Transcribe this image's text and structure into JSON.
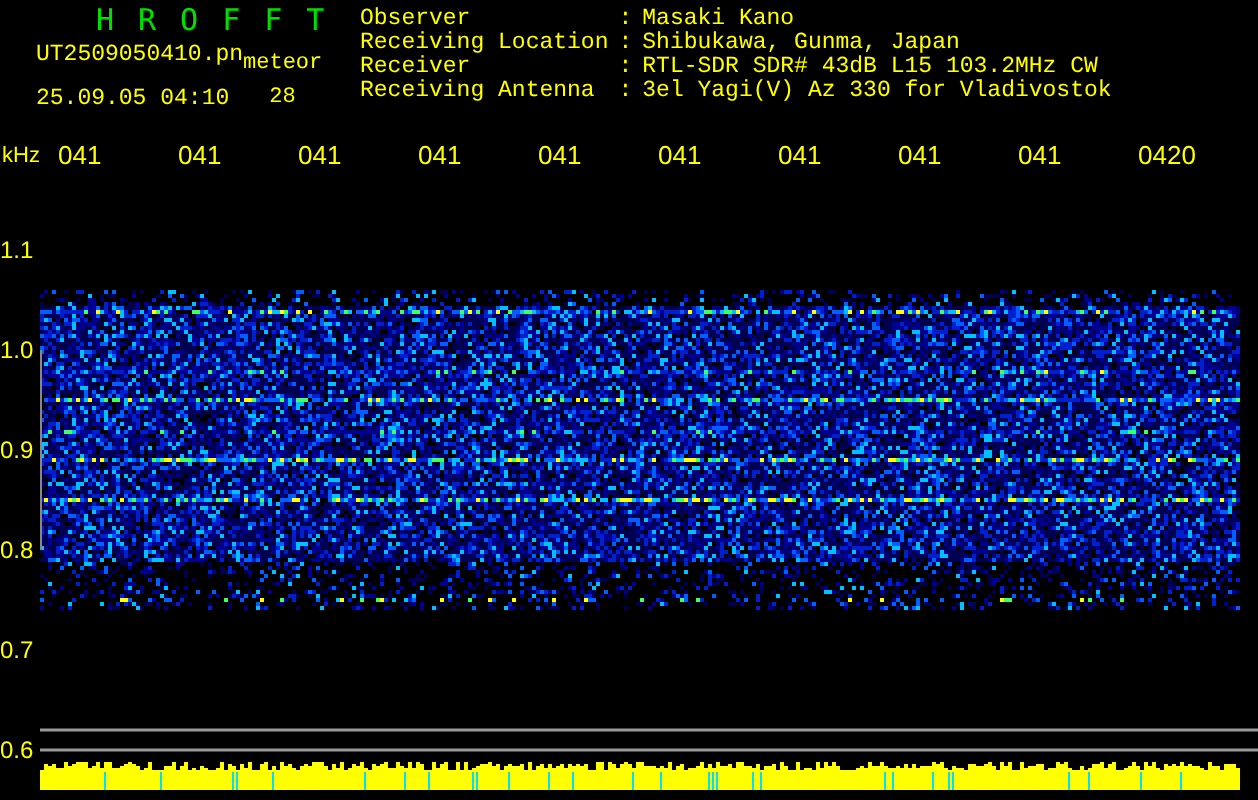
{
  "header": {
    "title": "HROFFT",
    "filename": "UT2509050410.pn",
    "mode": "meteor",
    "datetime": "25.09.05 04:10",
    "count": "28"
  },
  "info": [
    {
      "label": "Observer",
      "sep": ":",
      "value": "Masaki Kano"
    },
    {
      "label": "Receiving Location",
      "sep": ":",
      "value": "Shibukawa, Gunma, Japan"
    },
    {
      "label": "Receiver",
      "sep": ":",
      "value": "RTL-SDR SDR# 43dB L15 103.2MHz CW"
    },
    {
      "label": "Receiving Antenna",
      "sep": ":",
      "value": "3el Yagi(V) Az 330 for Vladivostok"
    }
  ],
  "unit": "kHz",
  "time_labels": [
    "041",
    "041",
    "041",
    "041",
    "041",
    "041",
    "041",
    "041",
    "041",
    "0420"
  ],
  "freq_labels": [
    "1.1",
    "1.0",
    "0.9",
    "0.8",
    "0.7",
    "0.6"
  ]
}
